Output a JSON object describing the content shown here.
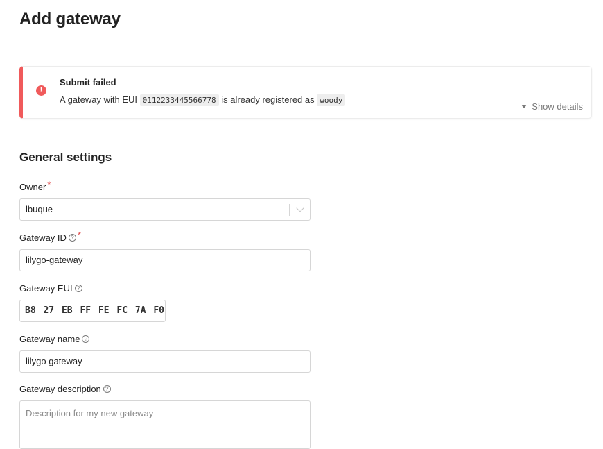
{
  "page": {
    "title": "Add gateway"
  },
  "notification": {
    "icon": "error-icon",
    "icon_glyph": "!",
    "title": "Submit failed",
    "message_prefix": "A gateway with EUI",
    "eui_code": "0112233445566778",
    "message_middle": "is already registered as",
    "owner_code": "woody",
    "show_details_label": "Show details",
    "accent_color": "#f05a5b"
  },
  "section": {
    "title": "General settings"
  },
  "form": {
    "owner": {
      "label": "Owner",
      "required": "*",
      "value": "lbuque"
    },
    "gateway_id": {
      "label": "Gateway ID",
      "required": "*",
      "help_icon": "?",
      "value": "lilygo-gateway"
    },
    "gateway_eui": {
      "label": "Gateway EUI",
      "help_icon": "?",
      "value": "B8 27 EB FF FE FC 7A F0"
    },
    "gateway_name": {
      "label": "Gateway name",
      "help_icon": "?",
      "value": "lilygo gateway"
    },
    "gateway_description": {
      "label": "Gateway description",
      "help_icon": "?",
      "placeholder": "Description for my new gateway",
      "value": ""
    }
  }
}
